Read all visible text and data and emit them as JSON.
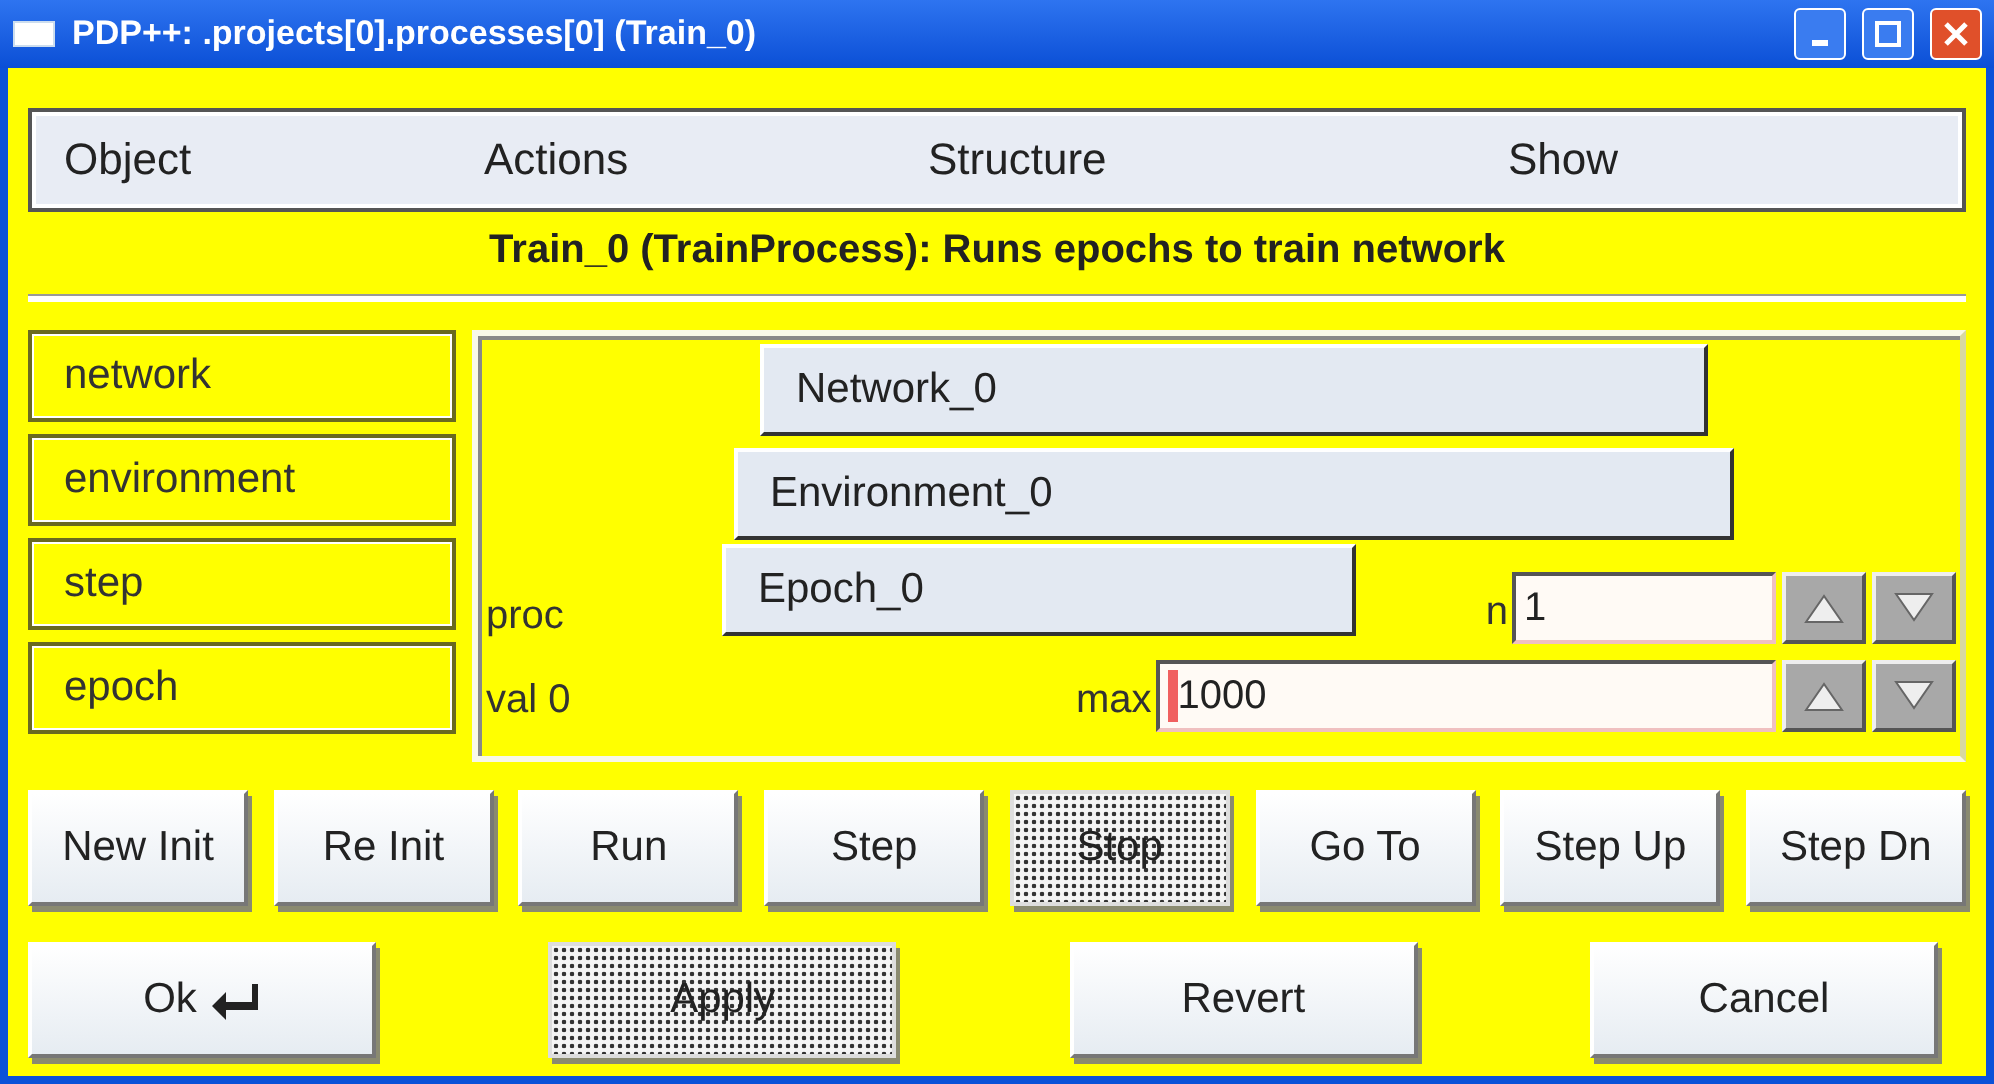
{
  "window": {
    "title": "PDP++:  .projects[0].processes[0] (Train_0)"
  },
  "menu": [
    "Object",
    "Actions",
    "Structure",
    "Show"
  ],
  "description": "Train_0 (TrainProcess):  Runs epochs to train network",
  "labels": [
    "network",
    "environment",
    "step",
    "epoch"
  ],
  "links": {
    "network": "Network_0",
    "environment": "Environment_0"
  },
  "step": {
    "label": "proc",
    "value": "Epoch_0",
    "n_label": "n",
    "n": {
      "value": "1",
      "focused": false
    }
  },
  "epoch": {
    "label": "val 0",
    "max_label": "max",
    "max": {
      "value": "1000",
      "focused": true
    }
  },
  "actions": [
    {
      "label": "New Init",
      "disabled": false
    },
    {
      "label": "Re Init",
      "disabled": false
    },
    {
      "label": "Run",
      "disabled": false
    },
    {
      "label": "Step",
      "disabled": false
    },
    {
      "label": "Stop",
      "disabled": true
    },
    {
      "label": "Go To",
      "disabled": false
    },
    {
      "label": "Step Up",
      "disabled": false
    },
    {
      "label": "Step Dn",
      "disabled": false
    }
  ],
  "dialog_buttons": [
    {
      "label": "Ok",
      "kind": "ok",
      "disabled": false
    },
    {
      "label": "Apply",
      "kind": "plain",
      "disabled": true
    },
    {
      "label": "Revert",
      "kind": "plain",
      "disabled": false
    },
    {
      "label": "Cancel",
      "kind": "plain",
      "disabled": false
    }
  ]
}
